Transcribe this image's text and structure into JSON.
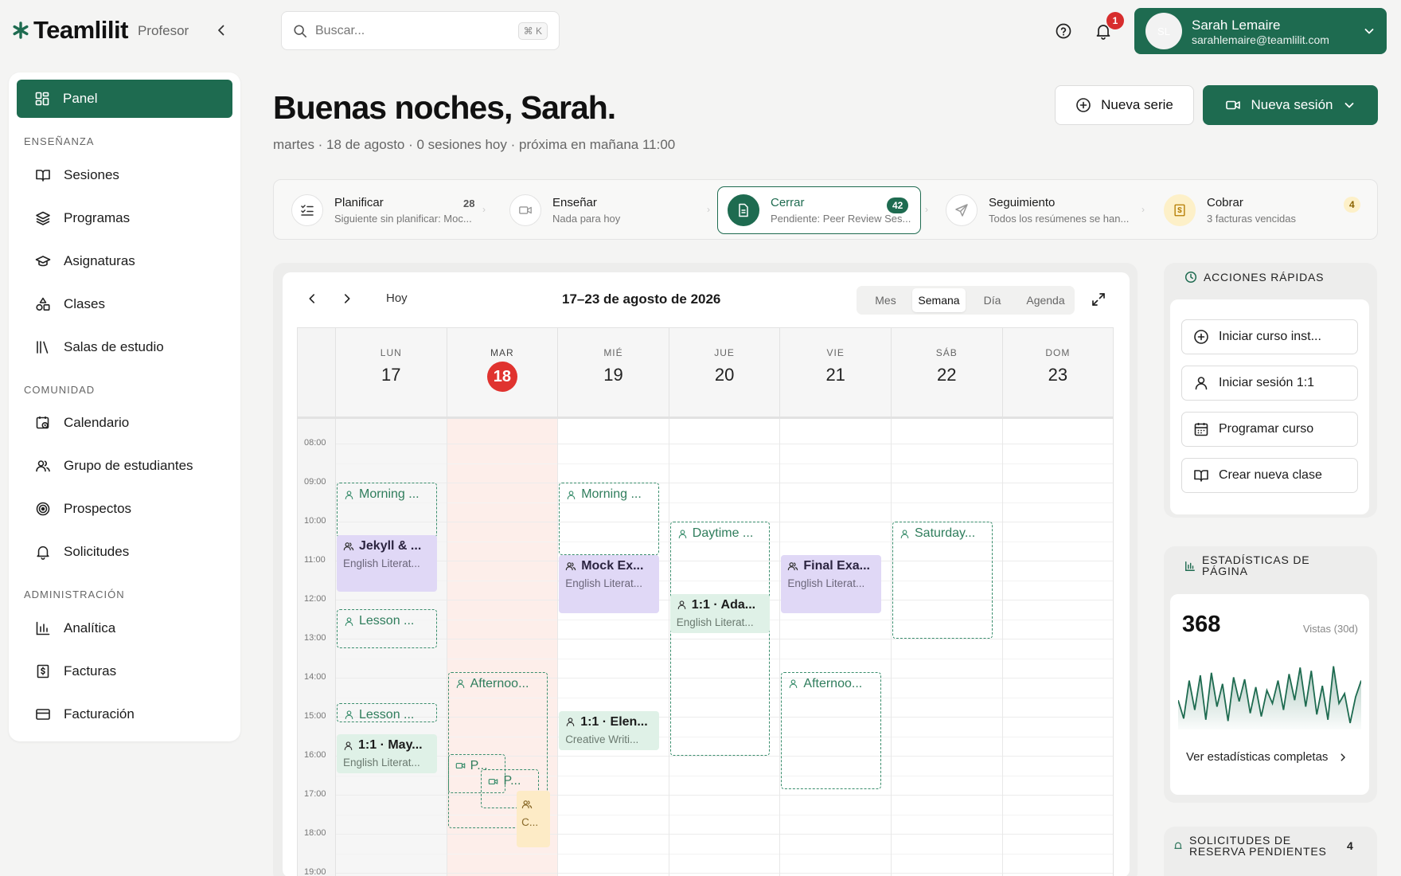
{
  "brand": {
    "name": "Teamlilit",
    "role": "Profesor"
  },
  "search": {
    "placeholder": "Buscar...",
    "shortcut": "⌘ K"
  },
  "notifications": {
    "count": "1"
  },
  "user": {
    "name": "Sarah Lemaire",
    "email": "sarahlemaire@teamlilit.com",
    "initials": "SL"
  },
  "sidebar": {
    "active": "Panel",
    "sections": [
      {
        "title": "ENSEÑANZA",
        "items": [
          "Sesiones",
          "Programas",
          "Asignaturas",
          "Clases",
          "Salas de estudio"
        ]
      },
      {
        "title": "COMUNIDAD",
        "items": [
          "Calendario",
          "Grupo de estudiantes",
          "Prospectos",
          "Solicitudes"
        ]
      },
      {
        "title": "ADMINISTRACIÓN",
        "items": [
          "Analítica",
          "Facturas",
          "Facturación"
        ]
      }
    ]
  },
  "header": {
    "greeting": "Buenas noches, Sarah.",
    "subtitle": "martes · 18 de agosto · 0 sesiones hoy · próxima en mañana 11:00",
    "new_series": "Nueva serie",
    "new_session": "Nueva sesión"
  },
  "steps": [
    {
      "title": "Planificar",
      "sub": "Siguiente sin planificar: Moc...",
      "count": "28"
    },
    {
      "title": "Enseñar",
      "sub": "Nada para hoy",
      "count": ""
    },
    {
      "title": "Cerrar",
      "sub": "Pendiente: Peer Review Ses...",
      "count": "42"
    },
    {
      "title": "Seguimiento",
      "sub": "Todos los resúmenes se han...",
      "count": ""
    },
    {
      "title": "Cobrar",
      "sub": "3 facturas vencidas",
      "count": "4"
    }
  ],
  "calendar": {
    "today_label": "Hoy",
    "range": "17–23 de agosto de 2026",
    "views": [
      "Mes",
      "Semana",
      "Día",
      "Agenda"
    ],
    "active_view": "Semana",
    "days": [
      {
        "name": "LUN",
        "num": "17"
      },
      {
        "name": "MAR",
        "num": "18"
      },
      {
        "name": "MIÉ",
        "num": "19"
      },
      {
        "name": "JUE",
        "num": "20"
      },
      {
        "name": "VIE",
        "num": "21"
      },
      {
        "name": "SÁB",
        "num": "22"
      },
      {
        "name": "DOM",
        "num": "23"
      }
    ],
    "today_index": 1,
    "times": [
      "08:00",
      "09:00",
      "10:00",
      "11:00",
      "12:00",
      "13:00",
      "14:00",
      "15:00",
      "16:00",
      "17:00",
      "18:00",
      "19:00"
    ],
    "events": [
      {
        "day": 0,
        "start": 9.0,
        "end": 10.4,
        "style": "dash",
        "icon": "person",
        "title": "Morning ...",
        "sub": ""
      },
      {
        "day": 0,
        "start": 10.35,
        "end": 11.8,
        "style": "purple",
        "icon": "group",
        "title": "Jekyll & ...",
        "sub": "English Literat..."
      },
      {
        "day": 0,
        "start": 12.25,
        "end": 13.25,
        "style": "dash",
        "icon": "person",
        "title": "Lesson ...",
        "sub": ""
      },
      {
        "day": 0,
        "start": 14.65,
        "end": 15.15,
        "style": "dash",
        "icon": "person",
        "title": "Lesson ...",
        "sub": ""
      },
      {
        "day": 0,
        "start": 15.45,
        "end": 16.45,
        "style": "green",
        "icon": "person",
        "title": "1:1 · May...",
        "sub": "English Literat..."
      },
      {
        "day": 1,
        "start": 13.85,
        "end": 17.85,
        "style": "dash",
        "icon": "person",
        "title": "Afternoo...",
        "sub": ""
      },
      {
        "day": 1,
        "start": 15.95,
        "end": 16.95,
        "style": "dash",
        "icon": "video",
        "title": "P...",
        "sub": "",
        "offset": 0.0,
        "width": 0.52
      },
      {
        "day": 1,
        "start": 16.35,
        "end": 17.35,
        "style": "dash",
        "icon": "video",
        "title": "P...",
        "sub": "",
        "offset": 0.3,
        "width": 0.52
      },
      {
        "day": 1,
        "start": 16.9,
        "end": 18.35,
        "style": "yellow",
        "icon": "group",
        "title": "",
        "sub": "C...",
        "offset": 0.62,
        "width": 0.3
      },
      {
        "day": 2,
        "start": 9.0,
        "end": 10.85,
        "style": "dash",
        "icon": "person",
        "title": "Morning ...",
        "sub": ""
      },
      {
        "day": 2,
        "start": 10.85,
        "end": 12.35,
        "style": "purple",
        "icon": "group",
        "title": "Mock Ex...",
        "sub": "English Literat..."
      },
      {
        "day": 2,
        "start": 14.85,
        "end": 15.85,
        "style": "green",
        "icon": "person",
        "title": "1:1 · Elen...",
        "sub": "Creative Writi..."
      },
      {
        "day": 3,
        "start": 10.0,
        "end": 16.0,
        "style": "dash",
        "icon": "person",
        "title": "Daytime ...",
        "sub": ""
      },
      {
        "day": 3,
        "start": 11.85,
        "end": 12.85,
        "style": "green",
        "icon": "person",
        "title": "1:1 · Ada...",
        "sub": "English Literat..."
      },
      {
        "day": 4,
        "start": 10.85,
        "end": 12.35,
        "style": "purple",
        "icon": "group",
        "title": "Final Exa...",
        "sub": "English Literat..."
      },
      {
        "day": 4,
        "start": 13.85,
        "end": 16.85,
        "style": "dash",
        "icon": "person",
        "title": "Afternoo...",
        "sub": ""
      },
      {
        "day": 5,
        "start": 10.0,
        "end": 13.0,
        "style": "dash",
        "icon": "person",
        "title": "Saturday...",
        "sub": ""
      }
    ]
  },
  "quick_actions": {
    "title": "ACCIONES RÁPIDAS",
    "items": [
      "Iniciar curso inst...",
      "Iniciar sesión 1:1",
      "Programar curso",
      "Crear nueva clase"
    ]
  },
  "stats": {
    "title_1": "ESTADÍSTICAS DE",
    "title_2": "PÁGINA",
    "views": "368",
    "views_label": "Vistas (30d)",
    "link": "Ver estadísticas completas",
    "sparkline": [
      40,
      12,
      70,
      25,
      78,
      10,
      82,
      30,
      65,
      8,
      75,
      38,
      72,
      20,
      60,
      15,
      55,
      35,
      70,
      25,
      80,
      40,
      90,
      30,
      85,
      18,
      62,
      10,
      92,
      35,
      50,
      5,
      45,
      70
    ],
    "accent": "#1e6b50"
  },
  "requests": {
    "title_1": "SOLICITUDES DE",
    "title_2": "RESERVA PENDIENTES",
    "count": "4"
  },
  "colors": {
    "primary": "#1e6b50",
    "today": "#e0332f",
    "purple_event": "#e0d8f6",
    "green_event": "#dff1e7"
  }
}
